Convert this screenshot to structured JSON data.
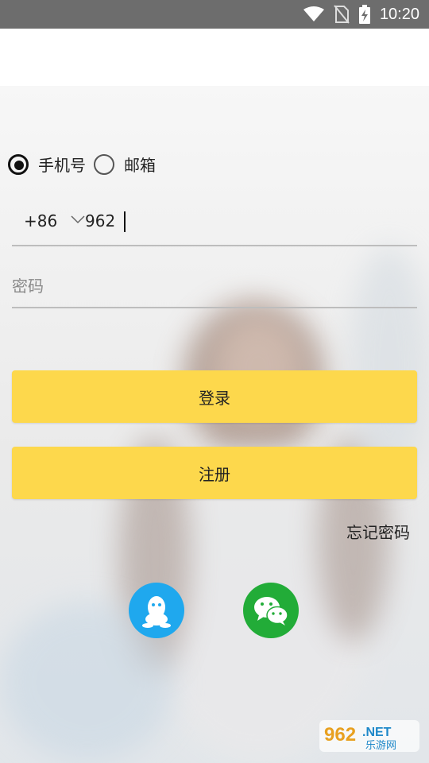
{
  "status_bar": {
    "time": "10:20",
    "icons": [
      "wifi-icon",
      "no-sim-icon",
      "battery-charging-icon"
    ]
  },
  "login_type": {
    "options": [
      {
        "label": "手机号",
        "selected": true
      },
      {
        "label": "邮箱",
        "selected": false
      }
    ]
  },
  "phone": {
    "country_code": "+86",
    "value": "962"
  },
  "password": {
    "placeholder": "密码"
  },
  "buttons": {
    "login": "登录",
    "register": "注册",
    "forgot": "忘记密码"
  },
  "social": [
    "qq-icon",
    "wechat-icon"
  ],
  "watermark": {
    "brand": "962.NET",
    "sub": "乐游网"
  },
  "colors": {
    "accent": "#fdd84c",
    "qq": "#1fa8ee",
    "wechat": "#22ac38"
  }
}
